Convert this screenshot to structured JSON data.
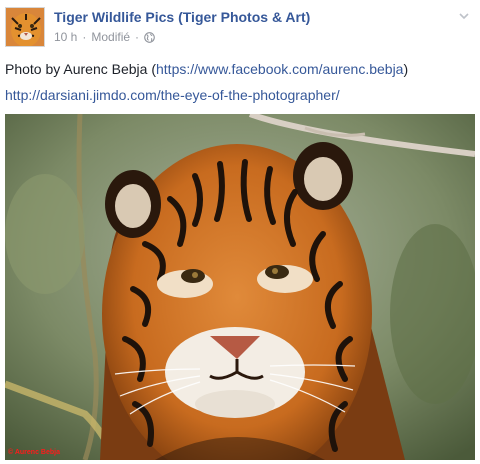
{
  "post": {
    "page_name": "Tiger Wildlife Pics (Tiger Photos & Art)",
    "time": "10 h",
    "edited": "Modifié",
    "separator": "·",
    "privacy_icon": "globe-icon",
    "menu_icon": "chevron-down-icon",
    "text_prefix": "Photo by Aurenc Bebja (",
    "text_link": "https://www.facebook.com/aurenc.bebja",
    "text_suffix": ")",
    "link2": "http://darsiani.jimdo.com/the-eye-of-the-photographer/",
    "photo_watermark": "© Aurenc Bebja"
  },
  "colors": {
    "link": "#365899",
    "meta": "#90949c",
    "text": "#1d2129"
  }
}
